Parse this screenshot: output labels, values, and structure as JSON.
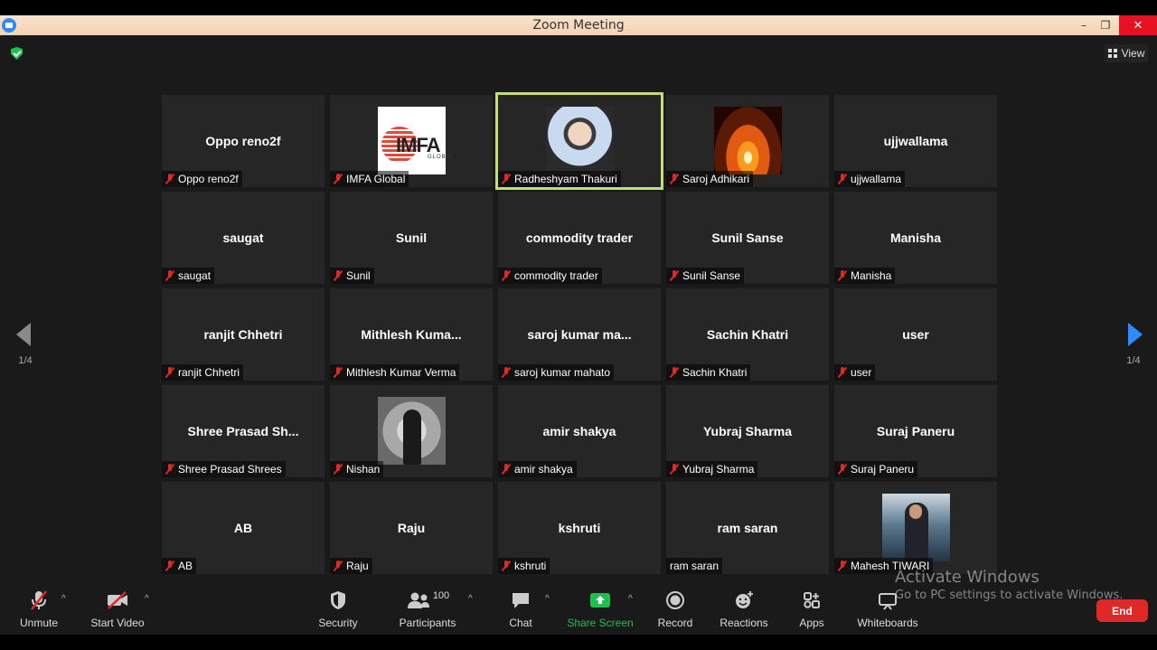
{
  "window": {
    "title": "Zoom Meeting",
    "minimize": "–",
    "restore": "❐",
    "close": "✕"
  },
  "view_button": {
    "label": "View"
  },
  "pagination": {
    "left": "1/4",
    "right": "1/4"
  },
  "tiles": [
    {
      "display": "Oppo reno2f",
      "label": "Oppo reno2f",
      "muted": true
    },
    {
      "display": "",
      "label": "IMFA Global",
      "muted": true,
      "image": "imfa-logo"
    },
    {
      "display": "",
      "label": "Radheshyam Thakuri",
      "muted": true,
      "image": "radheshyam-photo",
      "active": true
    },
    {
      "display": "",
      "label": "Saroj Adhikari",
      "muted": true,
      "image": "sunset-photo"
    },
    {
      "display": "ujjwallama",
      "label": "ujjwallama",
      "muted": true
    },
    {
      "display": "saugat",
      "label": "saugat",
      "muted": true
    },
    {
      "display": "Sunil",
      "label": "Sunil",
      "muted": true
    },
    {
      "display": "commodity trader",
      "label": "commodity trader",
      "muted": true
    },
    {
      "display": "Sunil Sanse",
      "label": "Sunil Sanse",
      "muted": true
    },
    {
      "display": "Manisha",
      "label": "Manisha",
      "muted": true
    },
    {
      "display": "ranjit Chhetri",
      "label": "ranjit Chhetri",
      "muted": true
    },
    {
      "display": "Mithlesh  Kuma...",
      "label": "Mithlesh  Kumar Verma",
      "muted": true
    },
    {
      "display": "saroj  kumar ma...",
      "label": "saroj kumar mahato",
      "muted": true
    },
    {
      "display": "Sachin Khatri",
      "label": "Sachin Khatri",
      "muted": true
    },
    {
      "display": "user",
      "label": "user",
      "muted": true
    },
    {
      "display": "Shree  Prasad  Sh...",
      "label": "Shree Prasad Shrees",
      "muted": true
    },
    {
      "display": "",
      "label": "Nishan",
      "muted": true,
      "image": "nishan-photo"
    },
    {
      "display": "amir shakya",
      "label": "amir shakya",
      "muted": true
    },
    {
      "display": "Yubraj Sharma",
      "label": "Yubraj Sharma",
      "muted": true
    },
    {
      "display": "Suraj Paneru",
      "label": "Suraj Paneru",
      "muted": true
    },
    {
      "display": "AB",
      "label": "AB",
      "muted": true
    },
    {
      "display": "Raju",
      "label": "Raju",
      "muted": true
    },
    {
      "display": "kshruti",
      "label": "kshruti",
      "muted": true
    },
    {
      "display": "ram saran",
      "label": "ram saran",
      "muted": false
    },
    {
      "display": "",
      "label": "Mahesh TIWARI",
      "muted": true,
      "image": "mahesh-photo"
    }
  ],
  "toolbar": {
    "unmute": "Unmute",
    "start_video": "Start Video",
    "security": "Security",
    "participants": "Participants",
    "participants_count": "100",
    "chat": "Chat",
    "share_screen": "Share Screen",
    "record": "Record",
    "reactions": "Reactions",
    "apps": "Apps",
    "whiteboards": "Whiteboards",
    "end": "End"
  },
  "watermark": {
    "line1": "Activate Windows",
    "line2": "Go to PC settings to activate Windows."
  },
  "colors": {
    "accent": "#2d8cff",
    "share_green": "#1dbf4e",
    "end_red": "#e02828",
    "active_speaker": "#c4dd77"
  }
}
